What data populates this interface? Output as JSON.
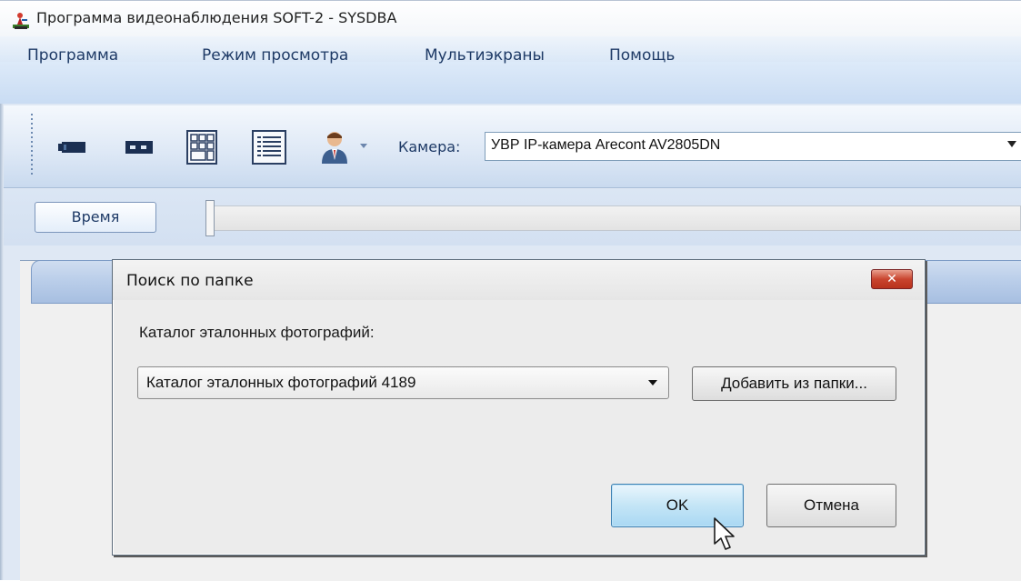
{
  "window": {
    "title": "Программа видеонаблюдения SOFT-2 - SYSDBA",
    "icon": "app-figure-icon"
  },
  "menu": {
    "items": [
      {
        "label": "Программа"
      },
      {
        "label": "Режим просмотра"
      },
      {
        "label": "Мультиэкраны"
      },
      {
        "label": "Помощь"
      }
    ]
  },
  "toolbar": {
    "buttons": [
      {
        "icon": "camera-icon"
      },
      {
        "icon": "two-cameras-icon"
      },
      {
        "icon": "multiscreen-grid-icon"
      },
      {
        "icon": "list-view-icon"
      },
      {
        "icon": "user-icon"
      }
    ],
    "camera_label": "Камера:",
    "camera_value": "УВР IP-камера Arecont AV2805DN"
  },
  "timebar": {
    "time_button": "Время"
  },
  "dialog": {
    "title": "Поиск по папке",
    "close_symbol": "✕",
    "catalog_label": "Каталог эталонных фотографий:",
    "catalog_value": "Каталог эталонных фотографий 4189",
    "add_button": "Добавить из папки...",
    "ok_button": "OK",
    "cancel_button": "Отмена"
  },
  "colors": {
    "accent_blue": "#1e3a66",
    "close_red": "#c9452f",
    "ok_highlight": "#c4e5f6"
  }
}
